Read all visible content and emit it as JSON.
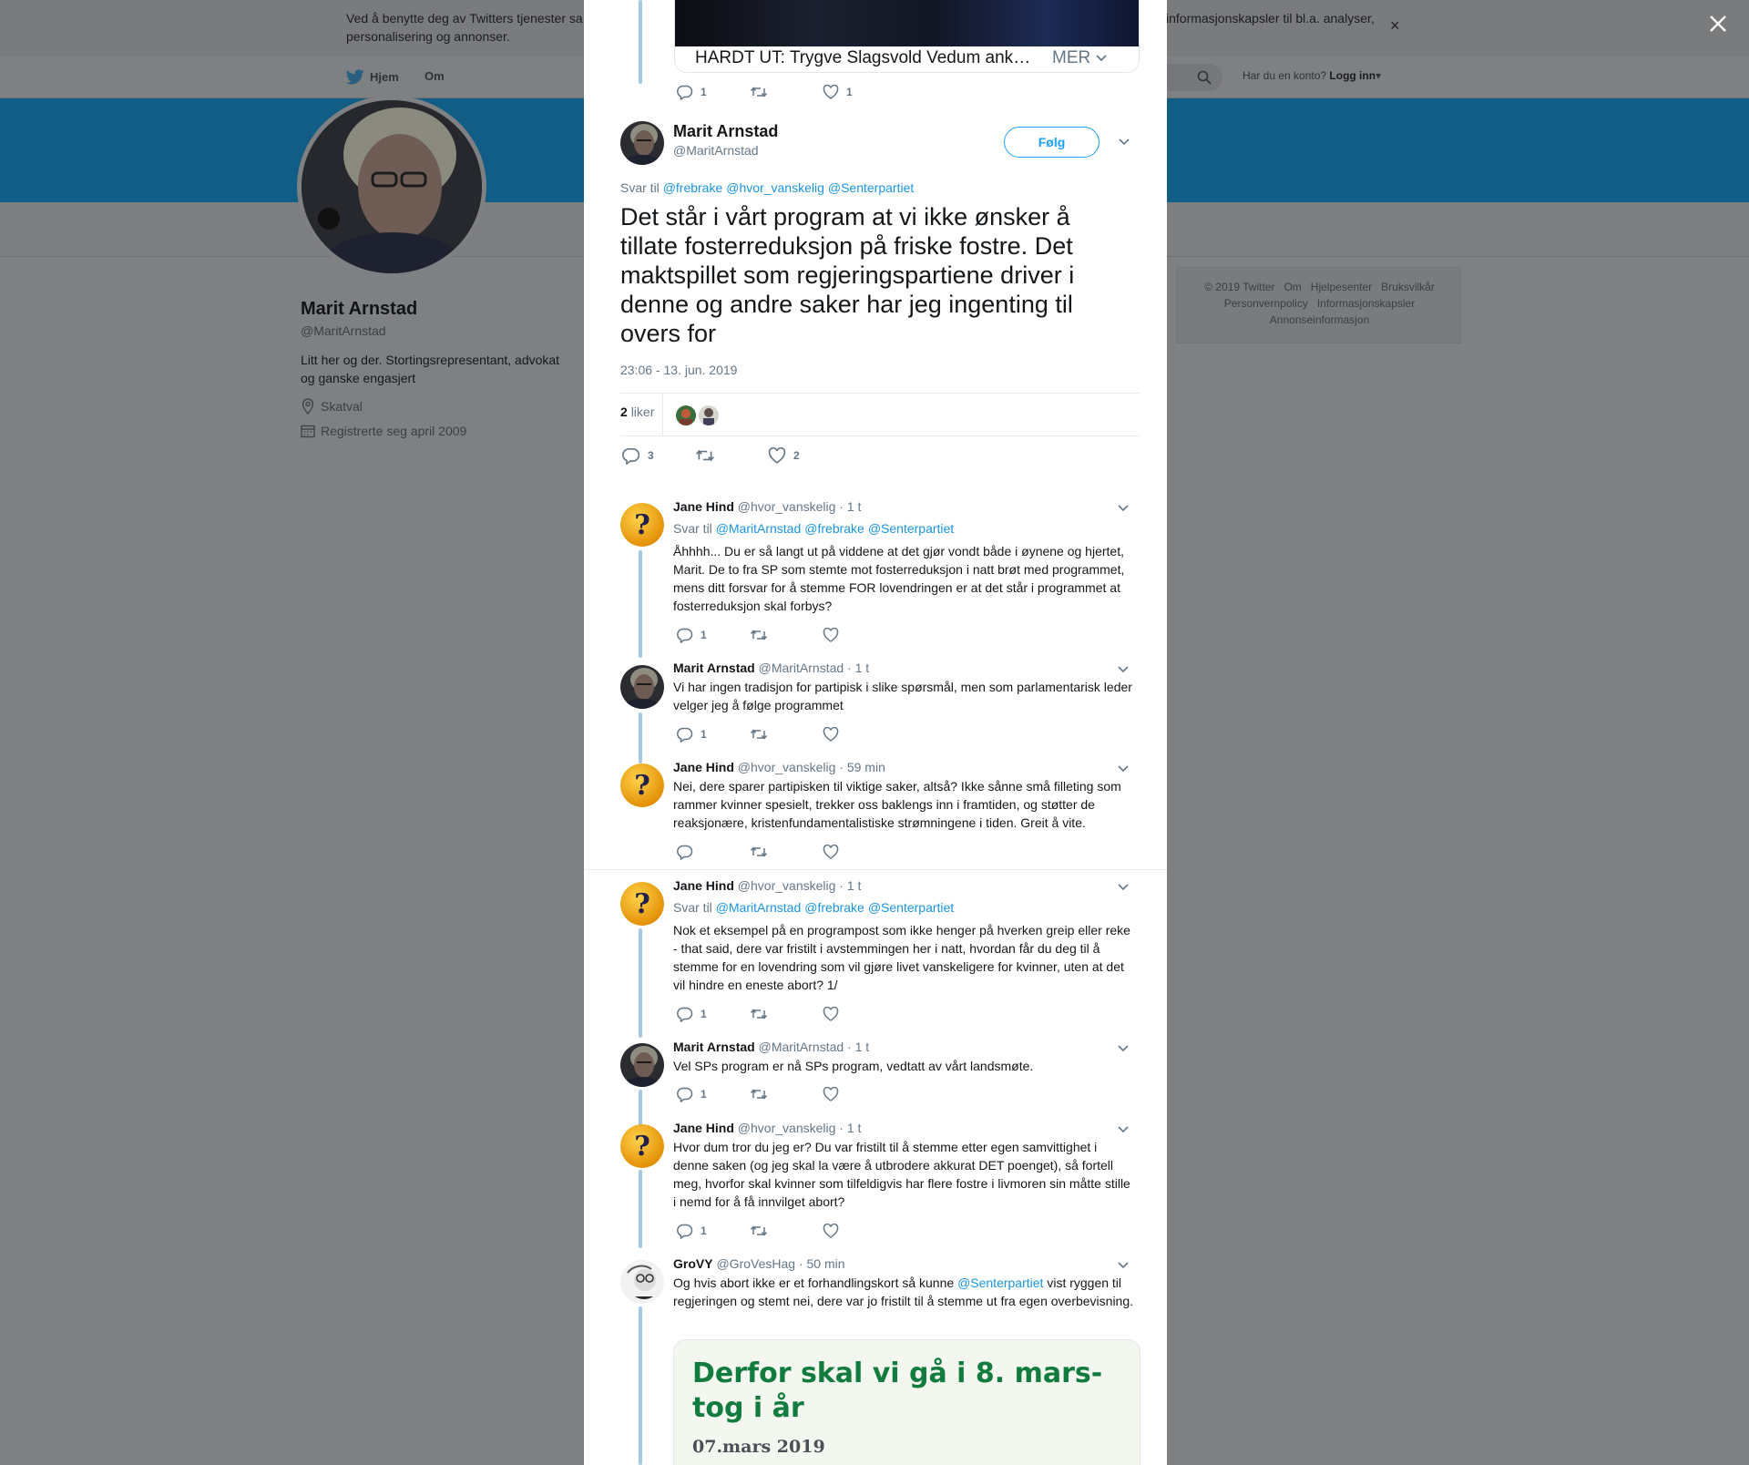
{
  "background": {
    "cookie": {
      "text_left": "Ved å benytte deg av Twitters tjenester sa personalisering og annonser.",
      "text_right": "informasjonskapsler til bl.a. analyser,",
      "close": "×"
    },
    "nav": {
      "home": "Hjem",
      "about": "Om",
      "has_account": "Har du en konto?",
      "login": "Logg inn"
    },
    "profile": {
      "name": "Marit Arnstad",
      "handle": "@MaritArnstad",
      "bio": "Litt her og der. Stortingsrepresentant, advokat og ganske engasjert",
      "location": "Skatval",
      "joined": "Registrerte seg april 2009"
    },
    "footer": {
      "line1": [
        "© 2019 Twitter",
        "Om",
        "Hjelpesenter",
        "Bruksvilkår"
      ],
      "line2": [
        "Personvernpolicy",
        "Informasjonskapsler"
      ],
      "line3": [
        "Annonseinformasjon"
      ]
    }
  },
  "modal": {
    "top_card": {
      "title": "HARDT UT: Trygve Slagsvold Vedum ankla…",
      "more": "MER",
      "replies": "1",
      "likes": "1"
    },
    "main_tweet": {
      "name": "Marit Arnstad",
      "handle": "@MaritArnstad",
      "follow": "Følg",
      "reply_prefix": "Svar til",
      "reply_to": [
        "@frebrake",
        "@hvor_vanskelig",
        "@Senterpartiet"
      ],
      "text": "Det står i vårt program at vi ikke ønsker å tillate fosterreduksjon på friske fostre. Det maktspillet som regjeringspartiene driver i denne og andre saker har jeg ingenting til overs for",
      "time": "23:06 - 13. jun. 2019",
      "likes_count": "2",
      "likes_label": "liker",
      "replies": "3",
      "like_total": "2"
    },
    "replies": [
      {
        "name": "Jane Hind",
        "handle": "@hvor_vanskelig",
        "time": "· 1 t",
        "reply_prefix": "Svar til",
        "reply_to": [
          "@MaritArnstad",
          "@frebrake",
          "@Senterpartiet"
        ],
        "text": "Åhhhh... Du er så langt ut på viddene at det gjør vondt både i øynene og hjertet, Marit. De to fra SP som stemte mot fosterreduksjon i natt brøt med programmet, mens ditt forsvar for å stemme FOR lovendringen er at det står i programmet at fosterreduksjon skal forbys?",
        "replies": "1"
      },
      {
        "name": "Marit Arnstad",
        "handle": "@MaritArnstad",
        "time": "· 1 t",
        "text": "Vi har ingen tradisjon for partipisk i slike spørsmål, men som parlamentarisk leder velger jeg å følge programmet",
        "replies": "1"
      },
      {
        "name": "Jane Hind",
        "handle": "@hvor_vanskelig",
        "time": "· 59 min",
        "text": "Nei, dere sparer partipisken til viktige saker, altså? Ikke sånne små filleting som rammer kvinner spesielt, trekker oss baklengs inn i framtiden, og støtter de reaksjonære, kristenfundamentalistiske strømningene i tiden. Greit å vite.",
        "replies": ""
      },
      {
        "name": "Jane Hind",
        "handle": "@hvor_vanskelig",
        "time": "· 1 t",
        "reply_prefix": "Svar til",
        "reply_to": [
          "@MaritArnstad",
          "@frebrake",
          "@Senterpartiet"
        ],
        "text": "Nok et eksempel på en programpost som ikke henger på hverken greip eller reke - that said, dere var fristilt i avstemmingen her i natt, hvordan får du deg til å stemme for en lovendring som vil gjøre livet vanskeligere for kvinner, uten at det vil hindre en eneste abort? 1/",
        "replies": "1"
      },
      {
        "name": "Marit Arnstad",
        "handle": "@MaritArnstad",
        "time": "· 1 t",
        "text": "Vel SPs program er nå SPs program, vedtatt av vårt landsmøte.",
        "replies": "1"
      },
      {
        "name": "Jane Hind",
        "handle": "@hvor_vanskelig",
        "time": "· 1 t",
        "text": "Hvor dum tror du jeg er? Du var fristilt til å stemme etter egen samvittighet i denne saken (og jeg skal la være å utbrodere akkurat DET poenget), så fortell meg, hvorfor skal kvinner som tilfeldigvis har flere fostre i livmoren sin måtte stille i nemd for å få innvilget abort?",
        "replies": "1"
      },
      {
        "name": "GroVY",
        "handle": "@GroVesHag",
        "time": "· 50 min",
        "text_before": "Og hvis abort ikke er et forhandlingskort så kunne",
        "mention": "@Senterpartiet",
        "text_after": "vist ryggen til regjeringen og stemt nei, dere var jo fristilt til å stemme ut fra egen overbevisning."
      }
    ],
    "link_card": {
      "title": "Derfor skal vi gå i 8. mars-tog i år",
      "date": "07.mars 2019"
    }
  },
  "colors": {
    "accent": "#1da1f2",
    "thread_line": "#a5c8e3",
    "card_green": "#117c3e"
  }
}
